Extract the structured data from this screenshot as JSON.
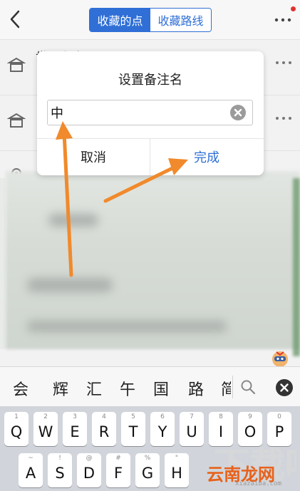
{
  "nav": {
    "tabs": [
      {
        "label": "收藏的点",
        "active": true
      },
      {
        "label": "收藏路线",
        "active": false
      }
    ],
    "back_icon": "chevron-left-icon",
    "more_icon": "more-horizontal-icon"
  },
  "list": {
    "first_title_partial": "世界主店",
    "items": [
      {
        "icon": "shop-icon"
      },
      {
        "icon": "shop-icon"
      },
      {
        "icon": "location-pin-icon"
      }
    ]
  },
  "dialog": {
    "title": "设置备注名",
    "input_value": "中",
    "cancel_label": "取消",
    "confirm_label": "完成"
  },
  "keyboard": {
    "candidates": [
      "会",
      "辉",
      "汇",
      "午",
      "国",
      "路",
      "简"
    ],
    "row1": [
      {
        "char": "Q",
        "hint": "1"
      },
      {
        "char": "W",
        "hint": "2"
      },
      {
        "char": "E",
        "hint": "3"
      },
      {
        "char": "R",
        "hint": "4"
      },
      {
        "char": "T",
        "hint": "5"
      },
      {
        "char": "Y",
        "hint": "6"
      },
      {
        "char": "U",
        "hint": "7"
      },
      {
        "char": "I",
        "hint": "8"
      },
      {
        "char": "O",
        "hint": "9"
      },
      {
        "char": "P",
        "hint": "0"
      }
    ],
    "row2": [
      {
        "char": "A",
        "hint": "~"
      },
      {
        "char": "S",
        "hint": "!"
      },
      {
        "char": "D",
        "hint": "@"
      },
      {
        "char": "F",
        "hint": "#"
      },
      {
        "char": "G",
        "hint": "%"
      },
      {
        "char": "H",
        "hint": "\""
      }
    ]
  },
  "watermark": {
    "text": "云南龙网",
    "sub": "xiazaiba.com"
  },
  "colors": {
    "accent": "#2f6fd6",
    "annotation_arrow": "#f08a2c"
  }
}
